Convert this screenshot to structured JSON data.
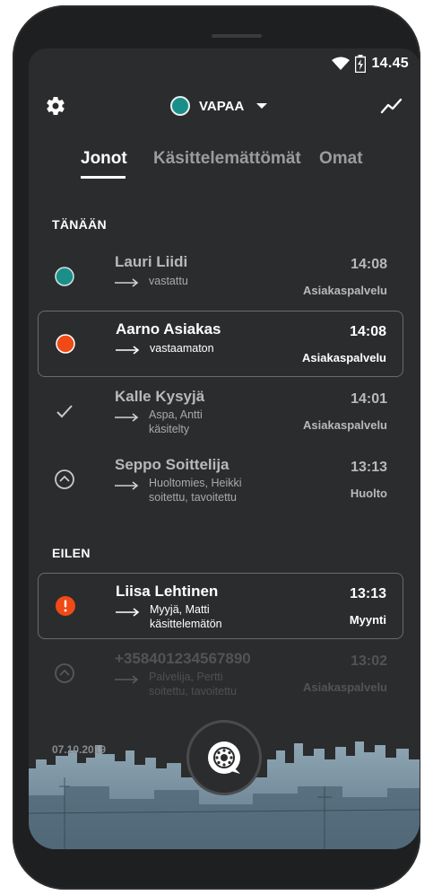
{
  "status_bar": {
    "time": "14.45",
    "icons": [
      "wifi-icon",
      "battery-icon"
    ]
  },
  "header": {
    "availability_label": "VAPAA",
    "availability_color": "#1a8f8a",
    "left_icon": "gear-icon",
    "right_icon": "trend-icon"
  },
  "tabs": [
    {
      "label": "Jonot",
      "active": true
    },
    {
      "label": "Käsittelemättömät",
      "active": false
    },
    {
      "label": "Omat",
      "active": false
    }
  ],
  "sections": {
    "today": "TÄNÄÄN",
    "yesterday": "EILEN"
  },
  "calls_today": [
    {
      "name": "Lauri Liidi",
      "line1": "vastattu",
      "line2": "",
      "time": "14:08",
      "dept": "Asiakaspalvelu",
      "icon": "status-dot-teal-icon"
    },
    {
      "name": "Aarno Asiakas",
      "line1": "vastaamaton",
      "line2": "",
      "time": "14:08",
      "dept": "Asiakaspalvelu",
      "icon": "status-dot-orange-icon"
    },
    {
      "name": "Kalle Kysyjä",
      "line1": "Aspa, Antti",
      "line2": "käsitelty",
      "time": "14:01",
      "dept": "Asiakaspalvelu",
      "icon": "checkmark-icon"
    },
    {
      "name": "Seppo Soittelija",
      "line1": "Huoltomies, Heikki",
      "line2": "soitettu, tavoitettu",
      "time": "13:13",
      "dept": "Huolto",
      "icon": "chevron-up-circle-icon"
    }
  ],
  "calls_yesterday": [
    {
      "name": "Liisa Lehtinen",
      "line1": "Myyjä, Matti",
      "line2": "käsittelemätön",
      "time": "13:13",
      "dept": "Myynti",
      "icon": "alert-icon"
    },
    {
      "name": "+358401234567890",
      "line1": "Palvelija, Pertti",
      "line2": "soitettu, tavoitettu",
      "time": "13:02",
      "dept": "Asiakaspalvelu",
      "icon": "chevron-up-circle-icon"
    }
  ],
  "footer": {
    "date": "07.10.2019",
    "fab_icon": "dial-icon"
  },
  "colors": {
    "background": "#2b2c2e",
    "accent_teal": "#1a8f8a",
    "alert_orange": "#f04a16"
  }
}
